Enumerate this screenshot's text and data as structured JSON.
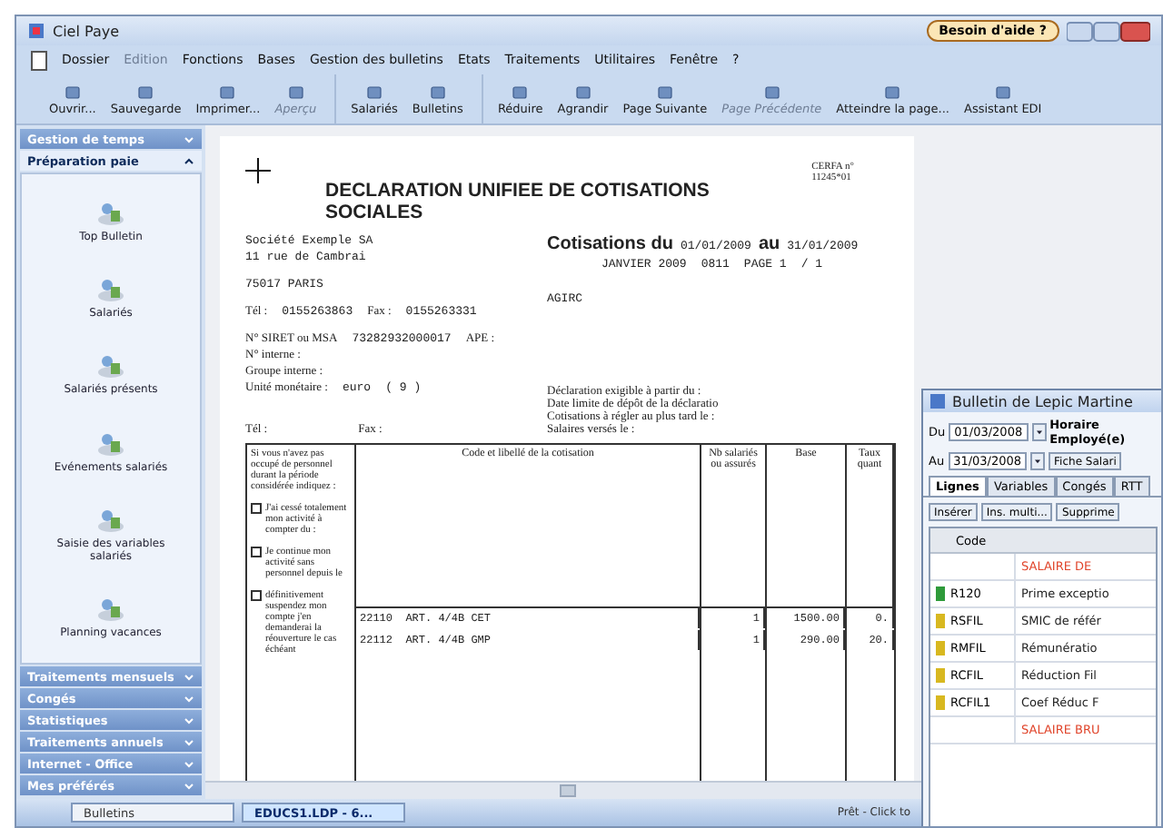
{
  "window": {
    "title": "Ciel Paye",
    "help_button": "Besoin d'aide ?"
  },
  "menu": [
    {
      "label": "Dossier",
      "disabled": false
    },
    {
      "label": "Edition",
      "disabled": true
    },
    {
      "label": "Fonctions",
      "disabled": false
    },
    {
      "label": "Bases",
      "disabled": false
    },
    {
      "label": "Gestion des bulletins",
      "disabled": false
    },
    {
      "label": "Etats",
      "disabled": false
    },
    {
      "label": "Traitements",
      "disabled": false
    },
    {
      "label": "Utilitaires",
      "disabled": false
    },
    {
      "label": "Fenêtre",
      "disabled": false
    },
    {
      "label": "?",
      "disabled": false
    }
  ],
  "toolbar": [
    [
      {
        "label": "Ouvrir...",
        "disabled": false
      },
      {
        "label": "Sauvegarde",
        "disabled": false
      },
      {
        "label": "Imprimer...",
        "disabled": false
      },
      {
        "label": "Aperçu",
        "disabled": true
      }
    ],
    [
      {
        "label": "Salariés",
        "disabled": false
      },
      {
        "label": "Bulletins",
        "disabled": false
      }
    ],
    [
      {
        "label": "Réduire",
        "disabled": false
      },
      {
        "label": "Agrandir",
        "disabled": false
      },
      {
        "label": "Page Suivante",
        "disabled": false
      },
      {
        "label": "Page Précédente",
        "disabled": true
      },
      {
        "label": "Atteindre la page...",
        "disabled": false
      },
      {
        "label": "Assistant EDI",
        "disabled": false
      }
    ]
  ],
  "sidebar": [
    {
      "label": "Gestion de temps",
      "expanded": false
    },
    {
      "label": "Préparation paie",
      "expanded": true,
      "items": [
        "Top Bulletin",
        "Salariés",
        "Salariés présents",
        "Evénements salariés",
        "Saisie des variables salariés",
        "Planning vacances"
      ]
    },
    {
      "label": "Traitements mensuels",
      "expanded": false
    },
    {
      "label": "Congés",
      "expanded": false
    },
    {
      "label": "Statistiques",
      "expanded": false
    },
    {
      "label": "Traitements annuels",
      "expanded": false
    },
    {
      "label": "Internet - Office",
      "expanded": false
    },
    {
      "label": "Mes préférés",
      "expanded": false
    }
  ],
  "document": {
    "title": "DECLARATION UNIFIEE DE COTISATIONS SOCIALES",
    "cerfa": "CERFA n° 11245*01",
    "company": [
      "Société Exemple SA",
      "11 rue de Cambrai"
    ],
    "city": "75017 PARIS",
    "tel_label": "Tél :",
    "tel": "0155263863",
    "fax_label": "Fax :",
    "fax": "0155263331",
    "siret_label": "N° SIRET ou MSA",
    "siret": "73282932000017",
    "ape_label": "APE :",
    "internal_label": "N° interne :",
    "group_label": "Groupe interne :",
    "currency_label": "Unité monétaire :",
    "currency": "euro",
    "currency_code": "( 9 )",
    "tel2_label": "Tél :",
    "fax2_label": "Fax :",
    "period_label": "Cotisations du",
    "period_from": "01/01/2009",
    "period_to_label": "au",
    "period_to": "31/01/2009",
    "month": "JANVIER 2009",
    "code": "0811",
    "page": "PAGE 1",
    "page_total": "/ 1",
    "body": "AGIRC",
    "deadlines": [
      "Déclaration exigible à partir du :",
      "Date limite de dépôt de la déclaratio",
      "Cotisations à régler au plus tard le :",
      "Salaires versés le :"
    ],
    "note": "Si vous n'avez pas occupé de personnel durant la période considérée indiquez :",
    "options": [
      {
        "label": "J'ai cessé totalement mon activité à compter du :",
        "checked": false
      },
      {
        "label": "Je continue mon activité sans personnel depuis le",
        "checked": false
      },
      {
        "label": "définitivement suspendez mon compte j'en demanderai la réouverture le cas échéant",
        "checked": false
      }
    ],
    "columns": [
      "Code et libellé de la cotisation",
      "Nb salariés ou assurés",
      "Base",
      "Taux quant"
    ],
    "rows": [
      [
        "22110  ART. 4/4B CET",
        "1",
        "1500.00",
        "0."
      ],
      [
        "22112  ART. 4/4B GMP",
        "1",
        "290.00",
        "20."
      ]
    ]
  },
  "taskbar": [
    {
      "label": "Bulletins",
      "selected": false
    },
    {
      "label": "EDUCS1.LDP - 6...",
      "selected": true
    }
  ],
  "status": "Prêt - Click to",
  "bulletin": {
    "title": "Bulletin de Lepic Martine",
    "from_label": "Du",
    "from": "01/03/2008",
    "to_label": "Au",
    "to": "31/03/2008",
    "schedule": "Horaire",
    "role": "Employé(e)",
    "sheet_button": "Fiche Salari",
    "tabs": [
      {
        "label": "Lignes",
        "selected": true
      },
      {
        "label": "Variables",
        "selected": false
      },
      {
        "label": "Congés",
        "selected": false
      },
      {
        "label": "RTT",
        "selected": false
      }
    ],
    "buttons": [
      "Insérer",
      "Ins. multi...",
      "Supprime"
    ],
    "column": "Code",
    "rows": [
      {
        "kind": "heading",
        "label": "SALAIRE DE"
      },
      {
        "kind": "line",
        "code": "R120",
        "label": "Prime exceptio",
        "color": "#2e9a3a"
      },
      {
        "kind": "line",
        "code": "RSFIL",
        "label": "SMIC de référ",
        "color": "#d8b820"
      },
      {
        "kind": "line",
        "code": "RMFIL",
        "label": "Rémunératio",
        "color": "#d8b820"
      },
      {
        "kind": "line",
        "code": "RCFIL",
        "label": "Réduction Fil",
        "color": "#d8b820"
      },
      {
        "kind": "line",
        "code": "RCFIL1",
        "label": "Coef Réduc F",
        "color": "#d8b820"
      },
      {
        "kind": "heading",
        "label": "SALAIRE BRU"
      }
    ]
  }
}
